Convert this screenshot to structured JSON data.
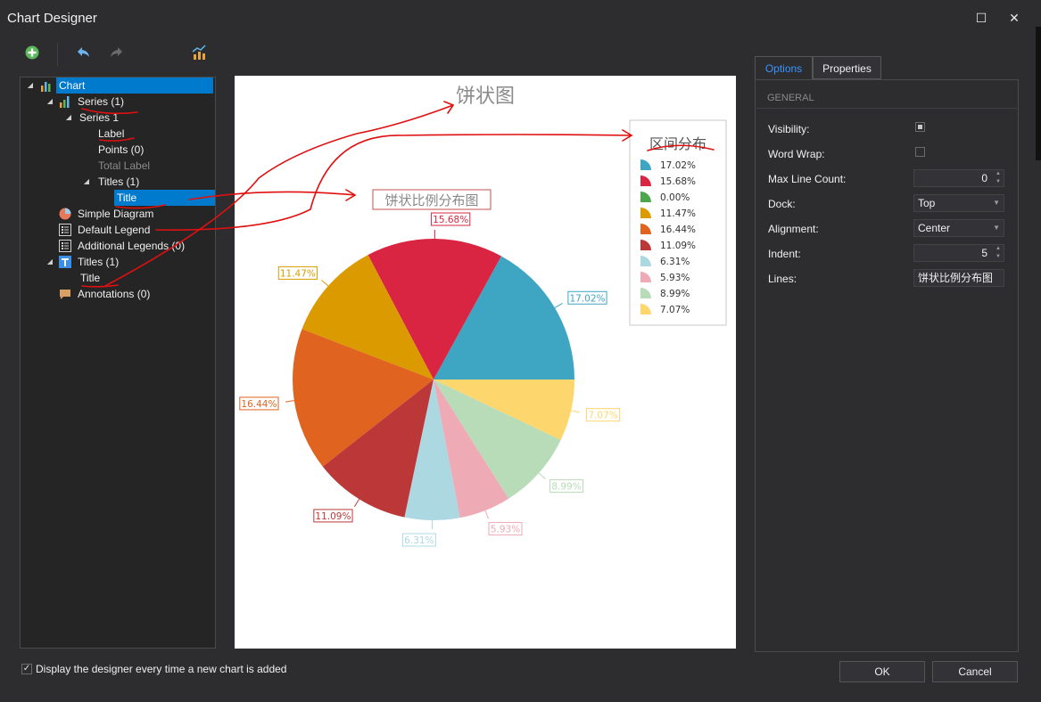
{
  "window": {
    "title": "Chart Designer",
    "maximize_glyph": "☐",
    "close_glyph": "✕"
  },
  "toolbar": {
    "add_icon": "add-icon",
    "undo_icon": "undo-icon",
    "redo_icon": "redo-icon",
    "wizard_icon": "chart-wizard-icon"
  },
  "tree": {
    "chart": "Chart",
    "series": "Series (1)",
    "series1": "Series 1",
    "label": "Label",
    "points": "Points (0)",
    "total_label": "Total Label",
    "series_titles": "Titles (1)",
    "series_title": "Title",
    "simple_diagram": "Simple Diagram",
    "default_legend": "Default Legend",
    "additional_legends": "Additional Legends (0)",
    "chart_titles": "Titles (1)",
    "chart_title": "Title",
    "annotations": "Annotations (0)"
  },
  "chart": {
    "main_title": "饼状图",
    "series_title": "饼状比例分布图",
    "legend_title": "区间分布"
  },
  "chart_data": {
    "type": "pie",
    "title": "饼状图",
    "subtitle": "饼状比例分布图",
    "legend_title": "区间分布",
    "legend_position": "top-right",
    "slices": [
      {
        "label": "17.02%",
        "value": 17.02,
        "color": "#3ea5c3"
      },
      {
        "label": "15.68%",
        "value": 15.68,
        "color": "#d92541"
      },
      {
        "label": "0.00%",
        "value": 0.0,
        "color": "#4da64d"
      },
      {
        "label": "11.47%",
        "value": 11.47,
        "color": "#db9b00"
      },
      {
        "label": "16.44%",
        "value": 16.44,
        "color": "#e06420"
      },
      {
        "label": "11.09%",
        "value": 11.09,
        "color": "#bc3838"
      },
      {
        "label": "6.31%",
        "value": 6.31,
        "color": "#acd8e2"
      },
      {
        "label": "5.93%",
        "value": 5.93,
        "color": "#eeaab5"
      },
      {
        "label": "8.99%",
        "value": 8.99,
        "color": "#b7dcb7"
      },
      {
        "label": "7.07%",
        "value": 7.07,
        "color": "#fdd66e"
      }
    ]
  },
  "tabs": {
    "options": "Options",
    "properties": "Properties"
  },
  "panel": {
    "general": "GENERAL",
    "visibility_label": "Visibility:",
    "word_wrap_label": "Word Wrap:",
    "max_line_count_label": "Max Line Count:",
    "max_line_count_value": "0",
    "dock_label": "Dock:",
    "dock_value": "Top",
    "alignment_label": "Alignment:",
    "alignment_value": "Center",
    "indent_label": "Indent:",
    "indent_value": "5",
    "lines_label": "Lines:",
    "lines_value": "饼状比例分布图"
  },
  "bottom": {
    "display_designer_label": "Display the designer every time a new chart is added",
    "ok": "OK",
    "cancel": "Cancel"
  }
}
